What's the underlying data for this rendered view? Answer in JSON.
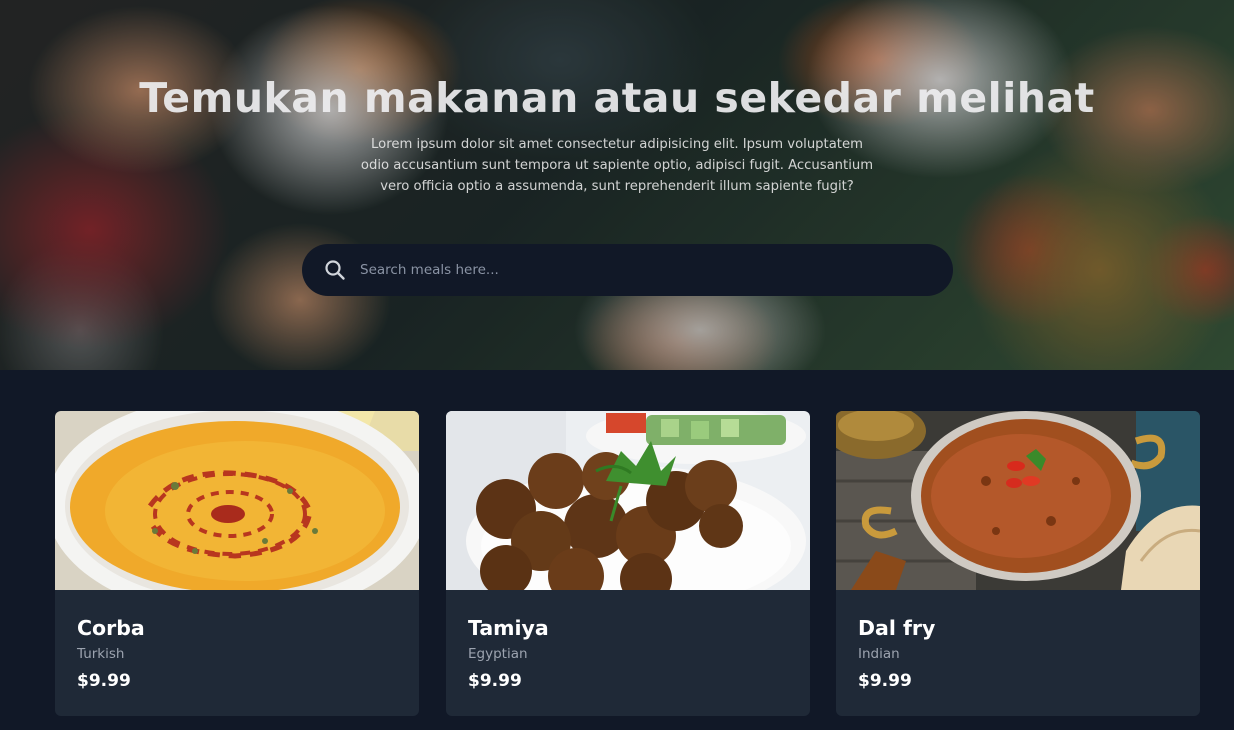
{
  "hero": {
    "title": "Temukan makanan atau sekedar melihat",
    "description": "Lorem ipsum dolor sit amet consectetur adipisicing elit. Ipsum voluptatem odio accusantium sunt tempora ut sapiente optio, adipisci fugit. Accusantium vero officia optio a assumenda, sunt reprehenderit illum sapiente fugit?"
  },
  "search": {
    "placeholder": "Search meals here...",
    "value": "",
    "icon": "search-icon"
  },
  "meals": [
    {
      "name": "Corba",
      "area": "Turkish",
      "price": "$9.99",
      "image": "lentil-soup"
    },
    {
      "name": "Tamiya",
      "area": "Egyptian",
      "price": "$9.99",
      "image": "falafel"
    },
    {
      "name": "Dal fry",
      "area": "Indian",
      "price": "$9.99",
      "image": "dal-curry"
    }
  ],
  "colors": {
    "page_background": "#111827",
    "card_background": "#1f2937",
    "search_background": "#111827",
    "muted_text": "#9ca3af",
    "text": "#ffffff"
  }
}
